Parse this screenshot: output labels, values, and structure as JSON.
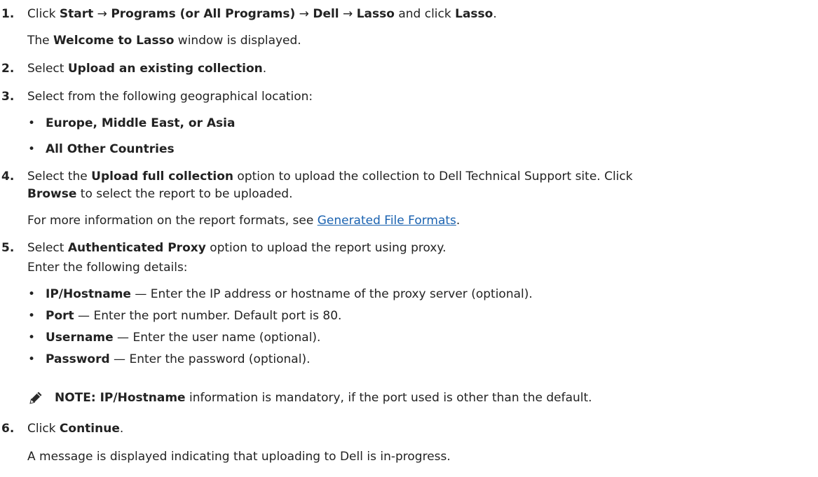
{
  "steps": [
    {
      "number": "1.",
      "parts": [
        "Click ",
        "Start",
        " → ",
        "Programs (or All Programs)",
        " → ",
        "Dell",
        " → ",
        "Lasso",
        " and click ",
        "Lasso",
        "."
      ],
      "sub": [
        "The ",
        "Welcome to Lasso",
        " window is displayed."
      ]
    },
    {
      "number": "2.",
      "parts": [
        "Select ",
        "Upload an existing collection",
        "."
      ]
    },
    {
      "number": "3.",
      "text": "Select from the following geographical location:",
      "bullets": [
        "Europe, Middle East, or Asia",
        "All Other Countries"
      ]
    },
    {
      "number": "4.",
      "line1": [
        "Select the ",
        "Upload full collection",
        " option to upload the collection to Dell Technical Support site. Click"
      ],
      "line2": [
        "Browse",
        " to select the report to be uploaded."
      ],
      "sub": [
        "For more information on the report formats, see ",
        "Generated File Formats",
        "."
      ]
    },
    {
      "number": "5.",
      "parts": [
        "Select ",
        "Authenticated Proxy",
        " option to upload the report using proxy."
      ],
      "sub": "Enter the following details:",
      "bullets": [
        {
          "term": "IP/Hostname",
          "desc": " — Enter the IP address or hostname of the proxy server (optional)."
        },
        {
          "term": "Port",
          "desc": " — Enter the port number. Default port is 80."
        },
        {
          "term": "Username",
          "desc": " — Enter the user name (optional)."
        },
        {
          "term": "Password",
          "desc": " — Enter the password (optional)."
        }
      ],
      "note": [
        "NOTE: ",
        "IP/Hostname",
        " information is mandatory, if the port used is other than the default."
      ]
    },
    {
      "number": "6.",
      "parts": [
        "Click ",
        "Continue",
        "."
      ],
      "sub": "A message is displayed indicating that uploading to Dell is in-progress."
    }
  ],
  "bullet_char": "•",
  "colors": {
    "text": "#222222",
    "link": "#1a62b0",
    "icon": "#2b2b2b"
  },
  "icons": {
    "note": "pencil-note-icon"
  }
}
